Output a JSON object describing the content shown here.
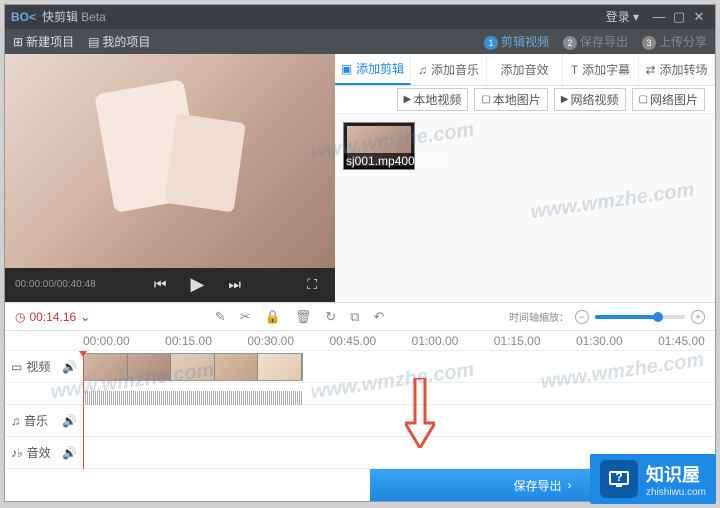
{
  "title": {
    "logo": "BO<",
    "name": "快剪辑",
    "beta": "Beta"
  },
  "win": {
    "login": "登录 ▾"
  },
  "menu": {
    "new": "新建项目",
    "my": "我的项目"
  },
  "steps": {
    "s1": "剪辑视频",
    "s2": "保存导出",
    "s3": "上传分享"
  },
  "player": {
    "time": "00:00:00/00:40:48"
  },
  "tabs": {
    "clip": "添加剪辑",
    "music": "添加音乐",
    "sfx": "添加音效",
    "sub": "添加字幕",
    "trans": "添加转场"
  },
  "sub": {
    "localv": "本地视频",
    "locali": "本地图片",
    "netv": "网络视频",
    "neti": "网络图片"
  },
  "clip": {
    "name": "sj001.mp4",
    "dur": "00:40:48"
  },
  "edit": {
    "timecode": "00:14.16",
    "zoomlabel": "时间轴缩放："
  },
  "ruler": {
    "t0": "00:00.00",
    "t1": "00:15.00",
    "t2": "00:30.00",
    "t3": "00:45.00",
    "t4": "01:00.00",
    "t5": "01:15.00",
    "t6": "01:30.00",
    "t7": "01:45.00"
  },
  "tracks": {
    "video": "视频",
    "music": "音乐",
    "sfx": "音效"
  },
  "export": "保存导出",
  "watermark": "www.wmzhe.com",
  "brand": {
    "cn": "知识屋",
    "en": "zhishiwu.com"
  }
}
